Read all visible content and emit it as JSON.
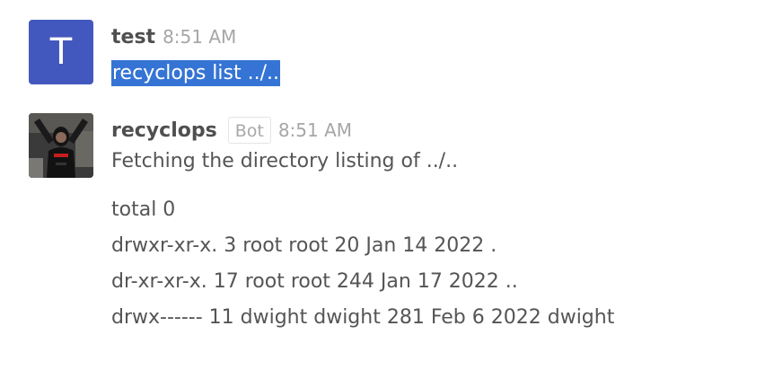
{
  "messages": [
    {
      "avatar_letter": "T",
      "username": "test",
      "time": "8:51 AM",
      "text": "recyclops list ../.."
    },
    {
      "username": "recyclops",
      "badge": "Bot",
      "time": "8:51 AM",
      "text": "Fetching the directory listing of ../..",
      "listing": [
        "total 0",
        "drwxr-xr-x. 3 root root 20 Jan 14 2022 .",
        "dr-xr-xr-x. 17 root root 244 Jan 17 2022 ..",
        "drwx------ 11 dwight dwight 281 Feb 6 2022 dwight"
      ]
    }
  ],
  "colors": {
    "avatar_background": "#4358be",
    "selection_highlight": "#3574d4"
  },
  "icons": {
    "bot_avatar": "user-photo-avatar"
  }
}
